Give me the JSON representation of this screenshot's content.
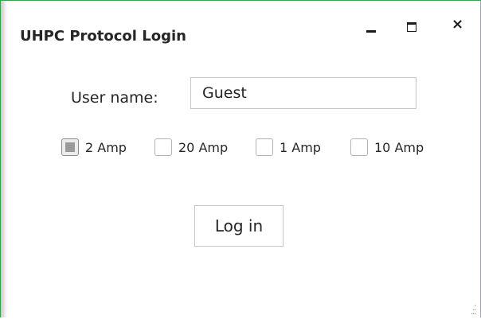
{
  "window": {
    "title": "UHPC Protocol Login",
    "controls": {
      "minimize_icon": "minimize-icon",
      "maximize_icon": "maximize-icon",
      "close_glyph": "×"
    },
    "accent_color": "#3aa04a"
  },
  "login": {
    "user_label": "User name:",
    "user_value": "Guest",
    "amp_options": [
      {
        "label": "2 Amp",
        "checked": true
      },
      {
        "label": "20 Amp",
        "checked": false
      },
      {
        "label": "1 Amp",
        "checked": false
      },
      {
        "label": "10 Amp",
        "checked": false
      }
    ],
    "login_button": "Log in"
  }
}
